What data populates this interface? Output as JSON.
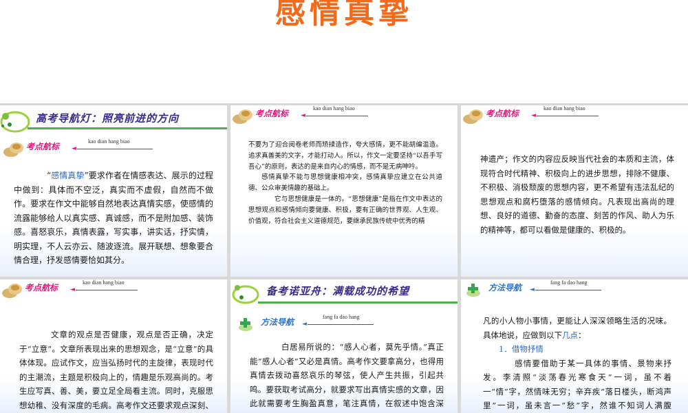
{
  "title": "感情真挚",
  "panels": {
    "p1": {
      "banner": "高考导航灯：照亮前进的方向",
      "tag_label": "考点航标",
      "tag_pinyin": "kao dian hang biao",
      "quote": "感情真挚",
      "text_after_quote": "”要求作者在情感表达、展示的过程中做到：具体而不空泛，真实而不虚假，自然而不做作。要求在作文中能够自然地表达真情实感，使感情的流露能够给人以真实感、真诚感，而不是附加感、装饰感。喜怒哀乐，真情表露，写实事，讲实话，抒实情，明实理，不人云亦云、随波逐流。展开联想、想象要合情合理，抒发感情要恰如其分。"
    },
    "p2": {
      "tag_label": "考点航标",
      "tag_pinyin": "kao dian hang biao",
      "para1": "不要为了迎合阅卷老师而矫揉造作，夸大感情，更不能胡编滥造。追求真善美的文字，才能打动人。所以，作文一定要坚持“以吾手写吾心”的原则，表达的是来自内心的情感，而不是无病呻吟。",
      "para2": "感情真挚不能与思想健康相冲突，感情真挚应建立在公共道德、公众审美情趣的基础上。",
      "para3": "它与思想健康是一体的。“思想健康”是指在作文中表达的思想观点和感情倾向要健康、积极，要有正确的世界观、人生观、价值观，符合社会主义道德规范，要继承民族传统中优秀的精"
    },
    "p3": {
      "tag_label": "考点航标",
      "tag_pinyin": "kao dian hang biao",
      "text": "神遗产；作文的内容应反映当代社会的本质和主流，体现符合时代精神、积极向上的进步思想，排除不健康、不积极、消极颓废的思想内容，更不希望有违法乱纪的思想观点和腐朽堕落的感情倾向。凡表现出高尚的理想、良好的道德、勤奋的态度、刻苦的作风、助人为乐的精神等，都可以看做是健康的、积极的。"
    },
    "p4": {
      "tag_label": "考点航标",
      "tag_pinyin": "kao dian hang biao",
      "text": "文章的观点是否健康，观点是否正确，决定于“立意”。文章所表现出来的思想观念，是“立意”的具体体现。应试作文，应当弘扬时代的主旋律，表现时代的主潮流，主题是积极向上的，情趣是乐观高尚的。考生应写真、善、美，要立足全局看主流。同时，克服思想幼稚、没有深度的毛病。高考作文还要求观点深刻、透彻，"
    },
    "p5": {
      "banner": "备考诺亚舟：满载成功的希望",
      "tag_label": "方法导航",
      "tag_pinyin": "fang fa dao hang",
      "text": "白居易所说的：“感人心者，莫先乎情。”真正能“感人心者”又必是真情。高考作文要拿高分，也得用真情去拨动喜怒哀乐的琴弦，使人产生共振，引起共鸣。要获取考试高分，就要求写出真情实感的文章，因此就需要考生胸盈真意，笔注真情，在叙述中饱含深情，在描写中凝聚真情"
    },
    "p6": {
      "tag_label": "方法导航",
      "tag_pinyin": "fang fa dao hang",
      "intro_pre": "凡的小人物小事情，更能让人深深领略生活的况味。具体地说，应做到以下",
      "intro_highlight": "几点",
      "intro_post": "：",
      "item_heading": "1．借物抒情",
      "item_text": "感情要借助于某一具体的事情、景物来抒发。李清照“淡荡春光寒食天”一词，虽不着一“情”字，然情味无穷；辛弃疾“落日楼头，断鸿声里”一词，虽未言一“愁”字，然谁不知词人满腹的“秋”滋味呢？李商隐词"
    }
  }
}
